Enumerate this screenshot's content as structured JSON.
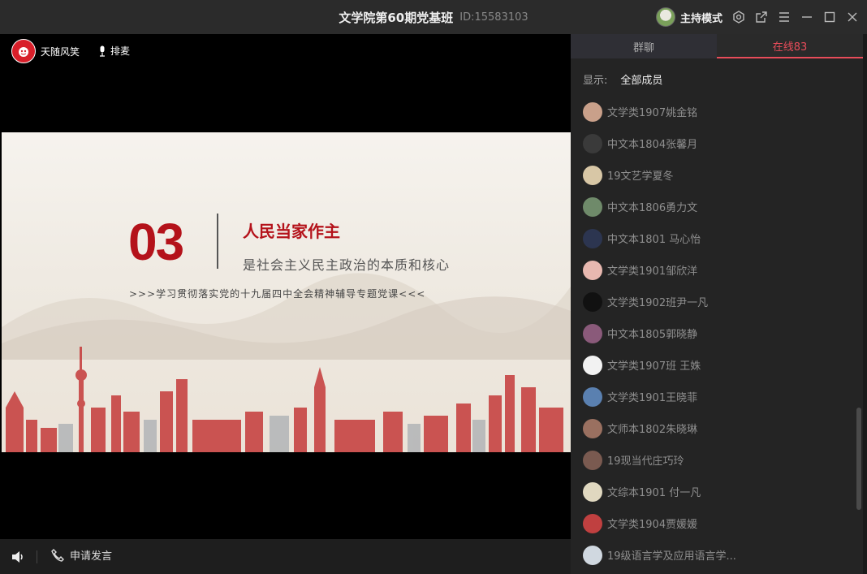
{
  "window": {
    "title": "文学院第60期党基班",
    "room_id": "ID:15583103",
    "host_mode_label": "主持模式"
  },
  "video": {
    "presenter_name": "天随风笑",
    "queue_label": "排麦"
  },
  "slide": {
    "number": "03",
    "heading": "人民当家作主",
    "subtitle": "是社会主义民主政治的本质和核心",
    "banner": ">>>学习贯彻落实党的十九届四中全会精神辅导专题党课<<<"
  },
  "bottom": {
    "apply_speak_label": "申请发言"
  },
  "sidebar": {
    "tabs": [
      {
        "label": "群聊",
        "active": false
      },
      {
        "label": "在线83",
        "active": true
      }
    ],
    "filter_label": "显示:",
    "filter_value": "全部成员",
    "members": [
      {
        "name": "文学类1907姚金铭",
        "avatar_color": "#c9a08a"
      },
      {
        "name": "中文本1804张馨月",
        "avatar_color": "#3a3a3a"
      },
      {
        "name": "19文艺学夏冬",
        "avatar_color": "#d8c7a6"
      },
      {
        "name": "中文本1806勇力文",
        "avatar_color": "#6f8a6a"
      },
      {
        "name": "中文本1801 马心怡",
        "avatar_color": "#2c3550"
      },
      {
        "name": "文学类1901邹欣洋",
        "avatar_color": "#e8b8b0"
      },
      {
        "name": "文学类1902班尹一凡",
        "avatar_color": "#111111"
      },
      {
        "name": "中文本1805郭晓静",
        "avatar_color": "#8a5a7a"
      },
      {
        "name": "文学类1907班 王姝",
        "avatar_color": "#f2f2f2"
      },
      {
        "name": "文学类1901王晓菲",
        "avatar_color": "#5a80b0"
      },
      {
        "name": "文师本1802朱晓琳",
        "avatar_color": "#9a7060"
      },
      {
        "name": "19现当代庄巧玲",
        "avatar_color": "#7a5a50"
      },
      {
        "name": "文综本1901 付一凡",
        "avatar_color": "#e0d8c0"
      },
      {
        "name": "文学类1904贾媛媛",
        "avatar_color": "#c04040"
      },
      {
        "name": "19级语言学及应用语言学...",
        "avatar_color": "#d0d8e0"
      }
    ]
  },
  "colors": {
    "accent": "#e84c5a",
    "slide_red": "#b4121a"
  }
}
